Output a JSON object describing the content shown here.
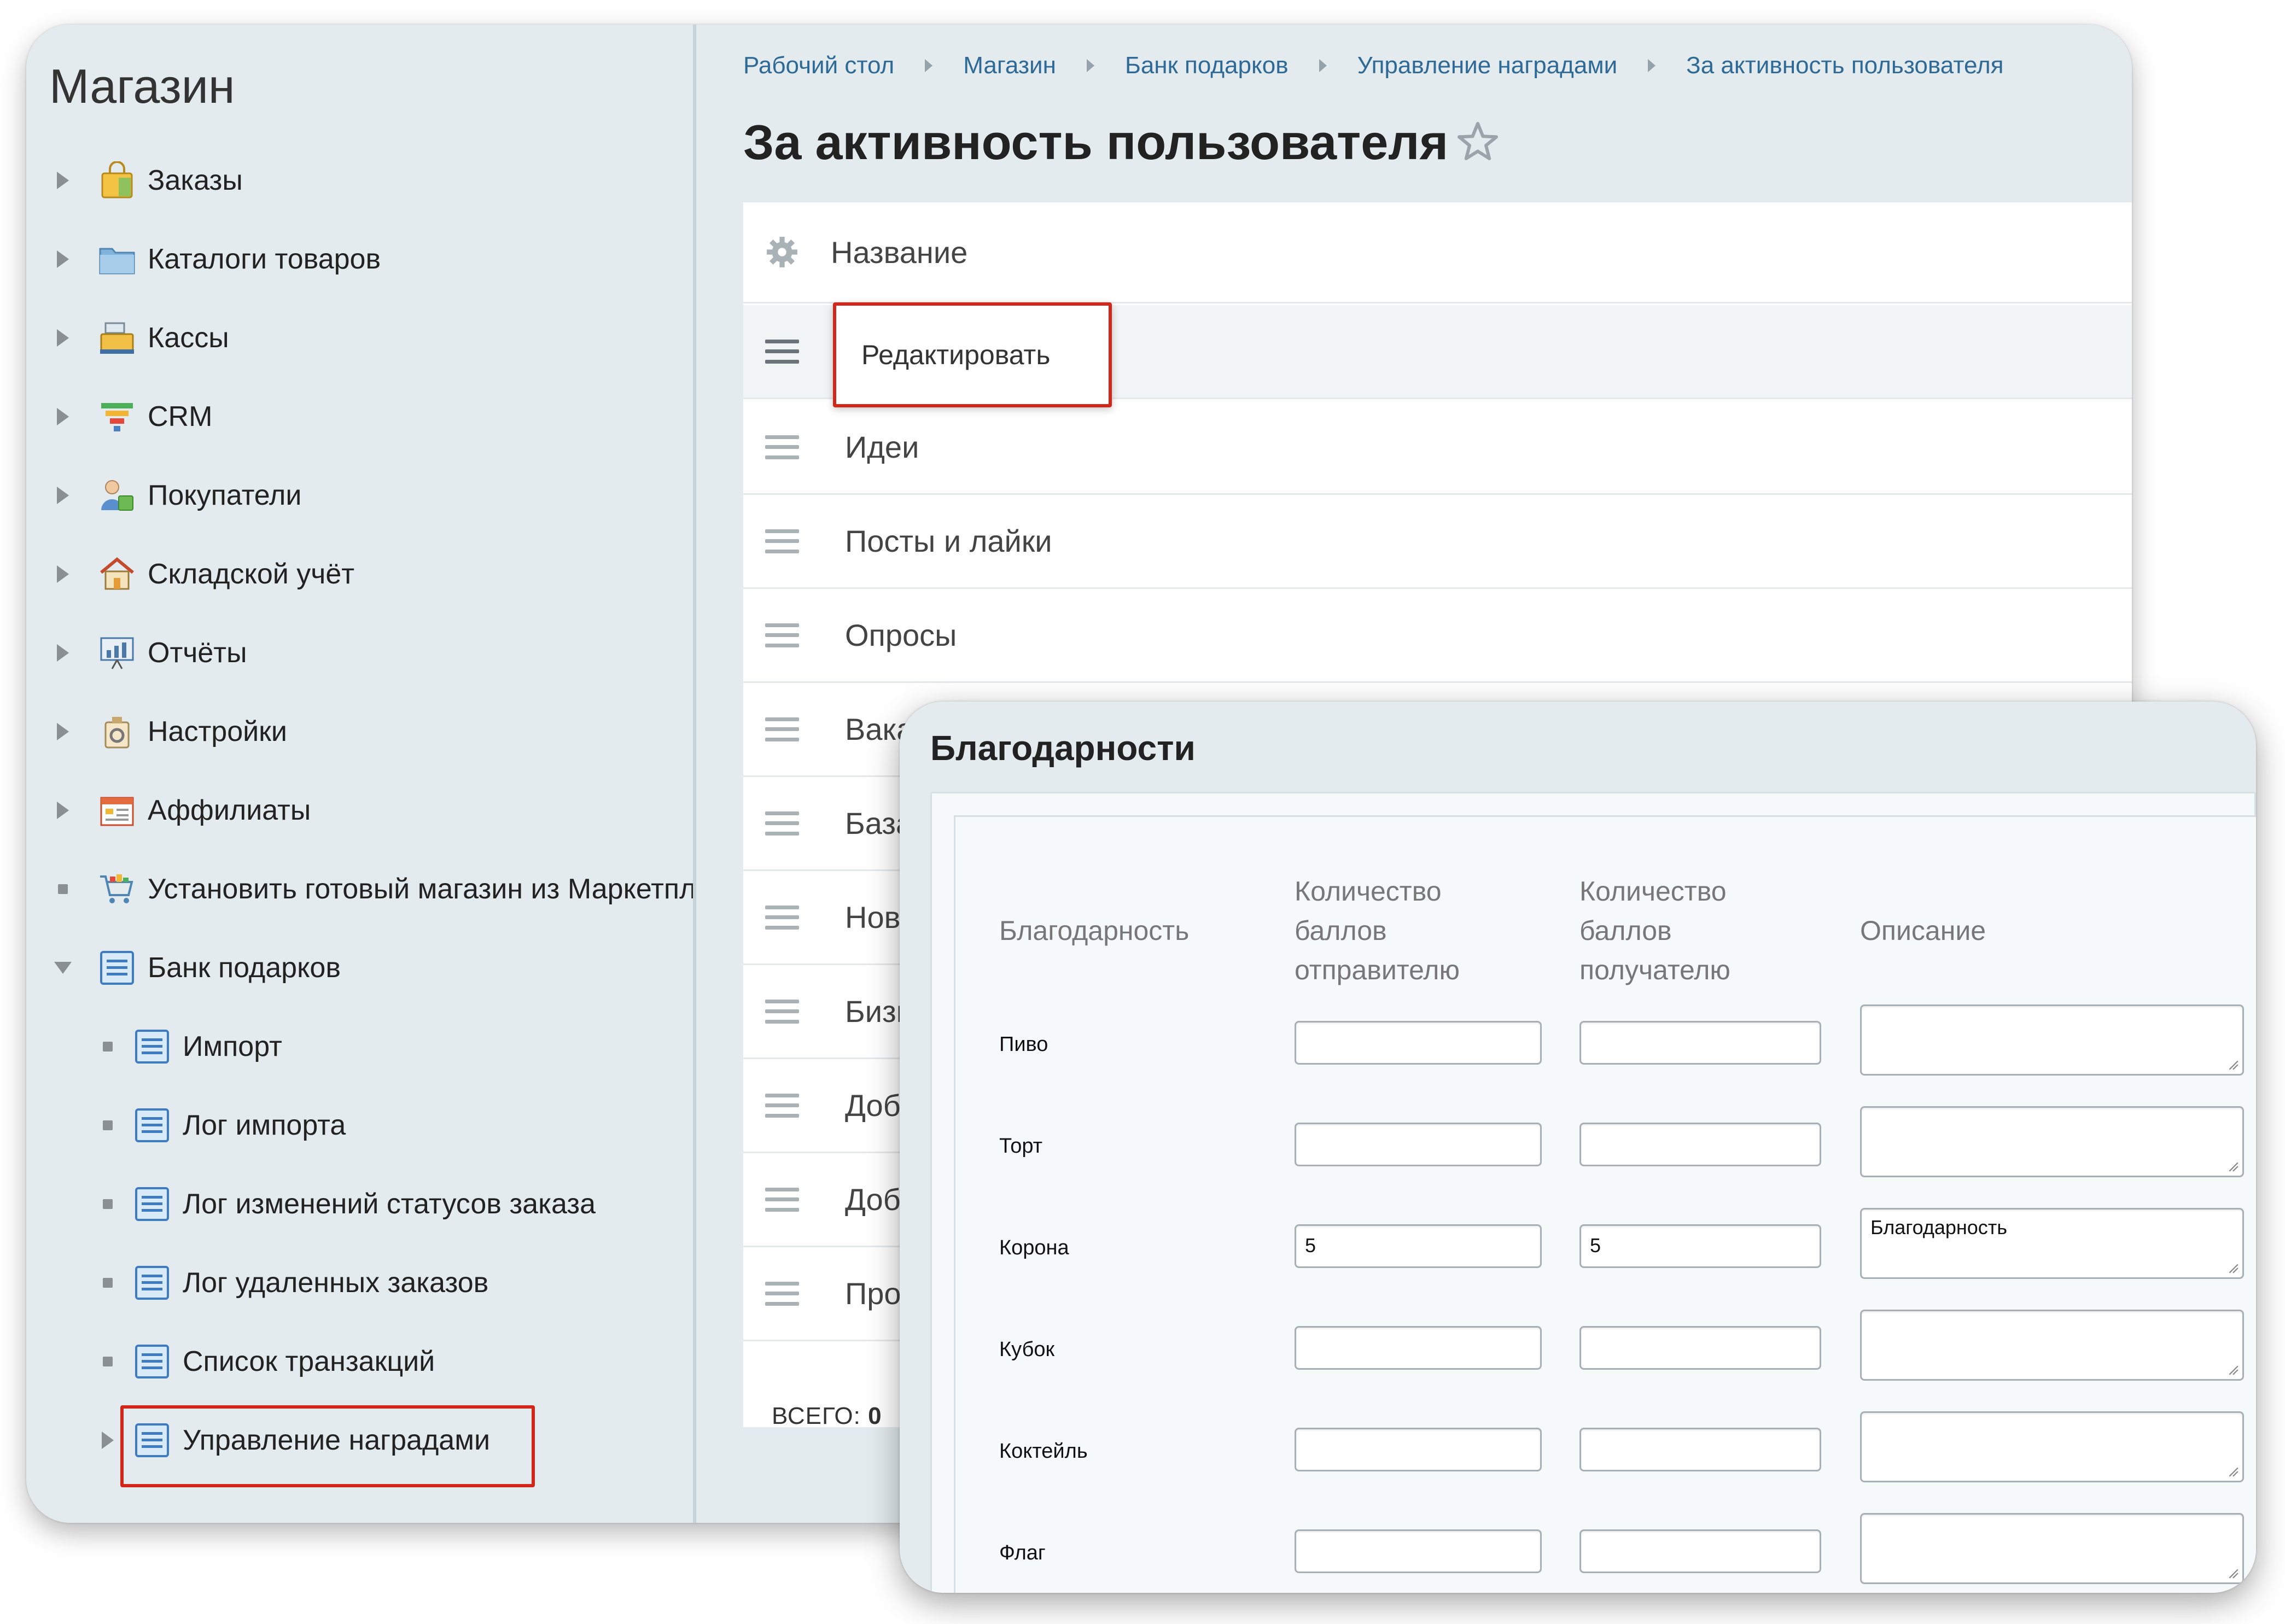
{
  "sidebar": {
    "title": "Магазин",
    "items": [
      {
        "label": "Заказы",
        "icon": "shopping-bag-icon"
      },
      {
        "label": "Каталоги товаров",
        "icon": "folder-icon"
      },
      {
        "label": "Кассы",
        "icon": "cash-register-icon"
      },
      {
        "label": "CRM",
        "icon": "funnel-icon"
      },
      {
        "label": "Покупатели",
        "icon": "customers-icon"
      },
      {
        "label": "Складской учёт",
        "icon": "warehouse-icon"
      },
      {
        "label": "Отчёты",
        "icon": "reports-icon"
      },
      {
        "label": "Настройки",
        "icon": "settings-icon"
      },
      {
        "label": "Аффилиаты",
        "icon": "affiliates-icon"
      },
      {
        "label": "Установить готовый магазин из Маркетплейса",
        "icon": "cart-icon"
      },
      {
        "label": "Банк подарков",
        "icon": "document-icon"
      }
    ],
    "subitems": [
      {
        "label": "Импорт"
      },
      {
        "label": "Лог импорта"
      },
      {
        "label": "Лог изменений статусов заказа"
      },
      {
        "label": "Лог удаленных заказов"
      },
      {
        "label": "Список транзакций"
      },
      {
        "label": "Управление наградами"
      }
    ]
  },
  "breadcrumb": [
    "Рабочий стол",
    "Магазин",
    "Банк подарков",
    "Управление наградами",
    "За активность пользователя"
  ],
  "page_title": "За активность пользователя",
  "grid": {
    "header": "Название",
    "rows": [
      "Идеи",
      "Посты и лайки",
      "Опросы",
      "Вакансии",
      "База знаний",
      "Новости",
      "Бизнес-процессы",
      "Добавление сотрудника",
      "Добавление задачи",
      "Прохождение теста"
    ],
    "total_label": "ВСЕГО:",
    "total_value": "0"
  },
  "context_menu": {
    "edit": "Редактировать"
  },
  "popup": {
    "title": "Благодарности",
    "headers": {
      "name": "Благодарность",
      "sender": [
        "Количество",
        "баллов",
        "отправителю"
      ],
      "receiver": [
        "Количество",
        "баллов",
        "получателю"
      ],
      "description": "Описание"
    },
    "rows": [
      {
        "name": "Пиво",
        "sender": "",
        "receiver": "",
        "description": ""
      },
      {
        "name": "Торт",
        "sender": "",
        "receiver": "",
        "description": ""
      },
      {
        "name": "Корона",
        "sender": "5",
        "receiver": "5",
        "description": "Благодарность"
      },
      {
        "name": "Кубок",
        "sender": "",
        "receiver": "",
        "description": ""
      },
      {
        "name": "Коктейль",
        "sender": "",
        "receiver": "",
        "description": ""
      },
      {
        "name": "Флаг",
        "sender": "",
        "receiver": "",
        "description": ""
      }
    ]
  },
  "colors": {
    "highlight": "#d3261b",
    "link": "#2f6a96",
    "panel_bg": "#e3ebee"
  }
}
